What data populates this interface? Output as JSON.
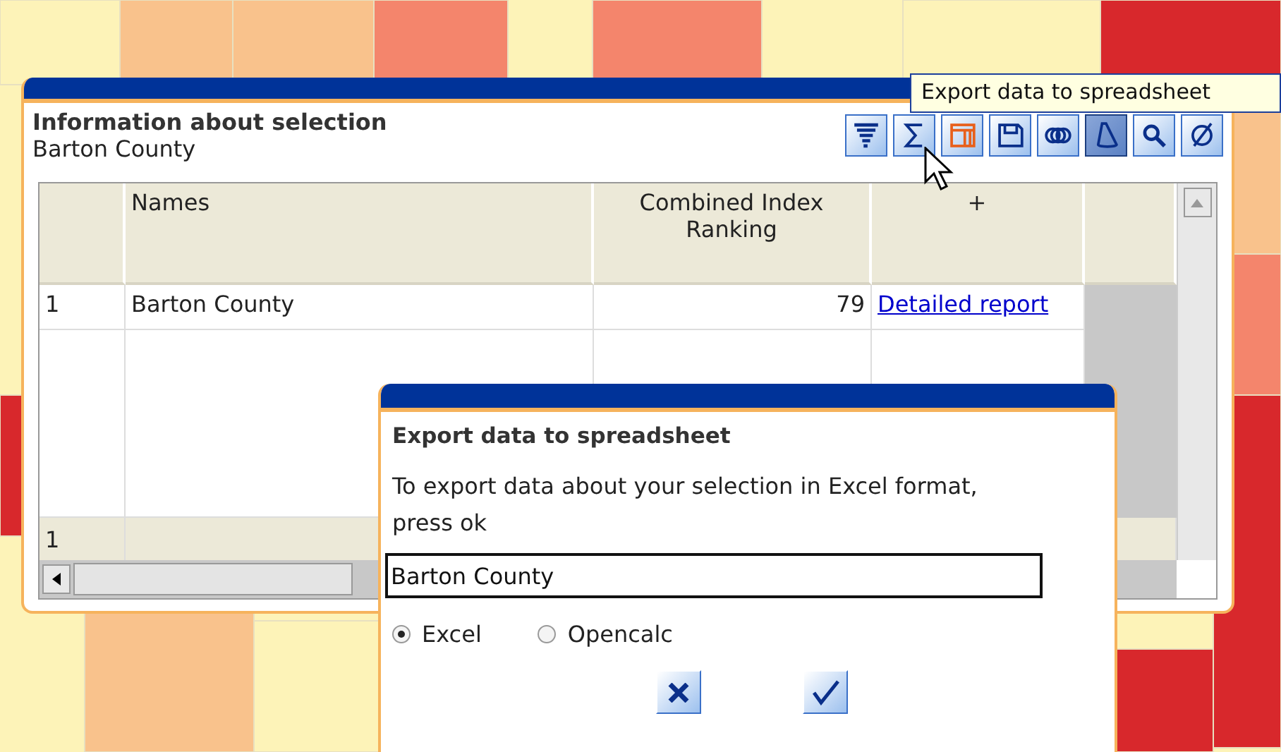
{
  "info_panel": {
    "title": "Information about selection",
    "subtitle": "Barton County",
    "toolbar": [
      {
        "kind": "sort",
        "selected": false,
        "highlighted": false
      },
      {
        "kind": "sum",
        "selected": false,
        "highlighted": false
      },
      {
        "kind": "export",
        "selected": false,
        "highlighted": true
      },
      {
        "kind": "save",
        "selected": false,
        "highlighted": false
      },
      {
        "kind": "rings",
        "selected": false,
        "highlighted": false
      },
      {
        "kind": "cone",
        "selected": true,
        "highlighted": false
      },
      {
        "kind": "zoom",
        "selected": false,
        "highlighted": false
      },
      {
        "kind": "clear",
        "selected": false,
        "highlighted": false
      }
    ],
    "table": {
      "columns": [
        "",
        "Names",
        "Combined Index Ranking",
        "+"
      ],
      "rows": [
        {
          "cells": [
            "1",
            "Barton County",
            "79"
          ],
          "link": "Detailed report"
        }
      ],
      "footer": [
        "1"
      ]
    }
  },
  "tooltip": {
    "text": "Export data to spreadsheet"
  },
  "export_dialog": {
    "title": "Export data to spreadsheet",
    "message": "To export data about your selection in Excel format, press ok",
    "value": "Barton County",
    "formats": [
      {
        "label": "Excel",
        "selected": true
      },
      {
        "label": "Opencalc",
        "selected": false
      }
    ],
    "buttons": [
      {
        "kind": "cancel"
      },
      {
        "kind": "ok"
      }
    ]
  }
}
